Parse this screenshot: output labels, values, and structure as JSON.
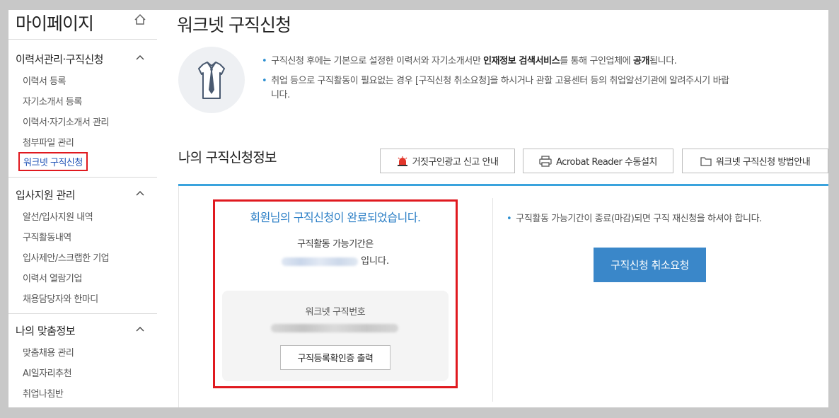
{
  "sidebar": {
    "title": "마이페이지",
    "sections": [
      {
        "title": "이력서관리·구직신청",
        "items": [
          "이력서 등록",
          "자기소개서 등록",
          "이력서·자기소개서 관리",
          "첨부파일 관리",
          "워크넷 구직신청"
        ]
      },
      {
        "title": "입사지원 관리",
        "items": [
          "알선/입사지원 내역",
          "구직활동내역",
          "입사제안/스크랩한 기업",
          "이력서 열람기업",
          "채용담당자와 한마디"
        ]
      },
      {
        "title": "나의 맞춤정보",
        "items": [
          "맞춤채용 관리",
          "AI일자리추천",
          "취업나침반"
        ]
      }
    ],
    "active_item": "워크넷 구직신청"
  },
  "main": {
    "title": "워크넷 구직신청",
    "notice1_pre": "구직신청 후에는 기본으로 설정한 이력서와 자기소개서만 ",
    "notice1_bold1": "인재정보 검색서비스",
    "notice1_mid": "를 통해 구인업체에 ",
    "notice1_bold2": "공개",
    "notice1_post": "됩니다.",
    "notice2_line1": "취업 등으로 구직활동이 필요없는 경우 [구직신청 취소요청]을 하시거나 관할 고용센터 등의 취업알선기관에 알려주시기 바랍",
    "notice2_line2": "니다.",
    "section_title": "나의 구직신청정보",
    "buttons": {
      "fake_ad": "거짓구인광고 신고 안내",
      "acrobat": "Acrobat Reader 수동설치",
      "guide": "워크넷 구직신청 방법안내"
    },
    "status": {
      "complete_msg": "회원님의 구직신청이 완료되었습니다.",
      "period_label": "구직활동 가능기간은",
      "period_suffix": "입니다.",
      "number_label": "워크넷 구직번호",
      "print_button": "구직등록확인증 출력"
    },
    "right": {
      "note": "구직활동 가능기간이 종료(마감)되면 구직 재신청을 하셔야 합니다.",
      "cancel_button": "구직신청 취소요청"
    }
  },
  "colors": {
    "accent_blue": "#3a87c9",
    "highlight_red": "#e0191f",
    "rule_blue": "#3aa3dd"
  }
}
